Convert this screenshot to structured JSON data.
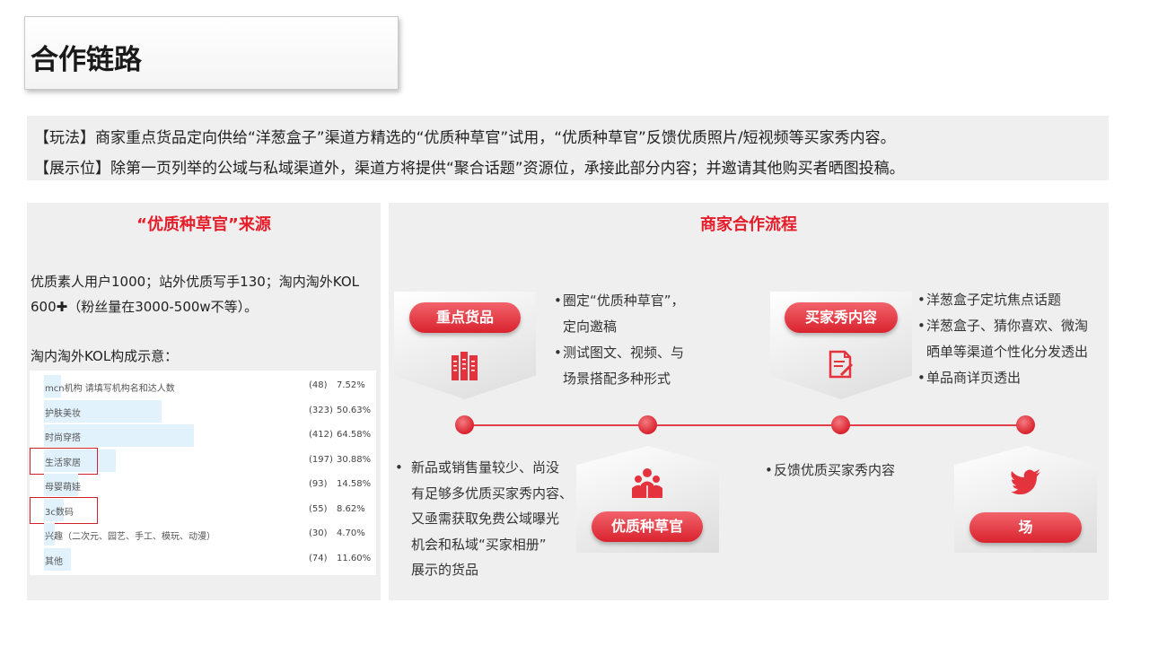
{
  "header": {
    "title": "合作链路"
  },
  "description": {
    "line1": "【玩法】商家重点货品定向供给“洋葱盒子”渠道方精选的“优质种草官”试用，“优质种草官”反馈优质照片/短视频等买家秀内容。",
    "line2": "【展示位】除第一页列举的公域与私域渠道外，渠道方将提供“聚合话题”资源位，承接此部分内容；并邀请其他购买者晒图投稿。"
  },
  "left_panel": {
    "title": "“优质种草官”来源",
    "sources_text": "优质素人用户1000；站外优质写手130；淘内淘外KOL 600✚（粉丝量在3000-500w不等）。",
    "composition_label": "淘内淘外KOL构成示意：",
    "kol_rows": [
      {
        "label": "mcn机构 请填写机构名和达人数",
        "count": "(48)",
        "percent": "7.52%",
        "share": 0.0752,
        "highlighted": false
      },
      {
        "label": "护肤美妆",
        "count": "(323)",
        "percent": "50.63%",
        "share": 0.5063,
        "highlighted": false
      },
      {
        "label": "时尚穿搭",
        "count": "(412)",
        "percent": "64.58%",
        "share": 0.6458,
        "highlighted": false
      },
      {
        "label": "生活家居",
        "count": "(197)",
        "percent": "30.88%",
        "share": 0.3088,
        "highlighted": true
      },
      {
        "label": "母婴萌娃",
        "count": "(93)",
        "percent": "14.58%",
        "share": 0.1458,
        "highlighted": false
      },
      {
        "label": "3c数码",
        "count": "(55)",
        "percent": "8.62%",
        "share": 0.0862,
        "highlighted": true
      },
      {
        "label": "兴趣（二次元、园艺、手工、模玩、动漫）",
        "count": "(30)",
        "percent": "4.70%",
        "share": 0.047,
        "highlighted": false
      },
      {
        "label": "其他",
        "count": "(74)",
        "percent": "11.60%",
        "share": 0.116,
        "highlighted": false
      }
    ]
  },
  "right_panel": {
    "title": "商家合作流程",
    "steps": {
      "key_goods": {
        "label": "重点货品",
        "icon": "books-icon"
      },
      "buyer_show": {
        "label": "买家秀内容",
        "icon": "document-icon"
      },
      "seeding_officer": {
        "label": "优质种草官",
        "icon": "people-icon"
      },
      "venue": {
        "label": "场",
        "icon": "bird-icon"
      }
    },
    "notes": {
      "key_goods": [
        "圈定“优质种草官”，",
        "定向邀稿",
        "测试图文、视频、与",
        "场景搭配多种形式"
      ],
      "buyer_show": [
        "洋葱盒子定坑焦点话题",
        "洋葱盒子、猜你喜欢、微淘",
        "晒单等渠道个性化分发透出",
        "单品商详页透出"
      ],
      "product_selection": [
        "新品或销售量较少、尚没",
        "有足够多优质买家秀内容、",
        "又亟需获取免费公域曝光",
        "机会和私域“买家相册”",
        "展示的货品"
      ],
      "feedback": [
        "反馈优质买家秀内容"
      ]
    }
  },
  "colors": {
    "accent": "#e51d2a",
    "bar": "#e1f2fd",
    "panel": "#efefef"
  }
}
